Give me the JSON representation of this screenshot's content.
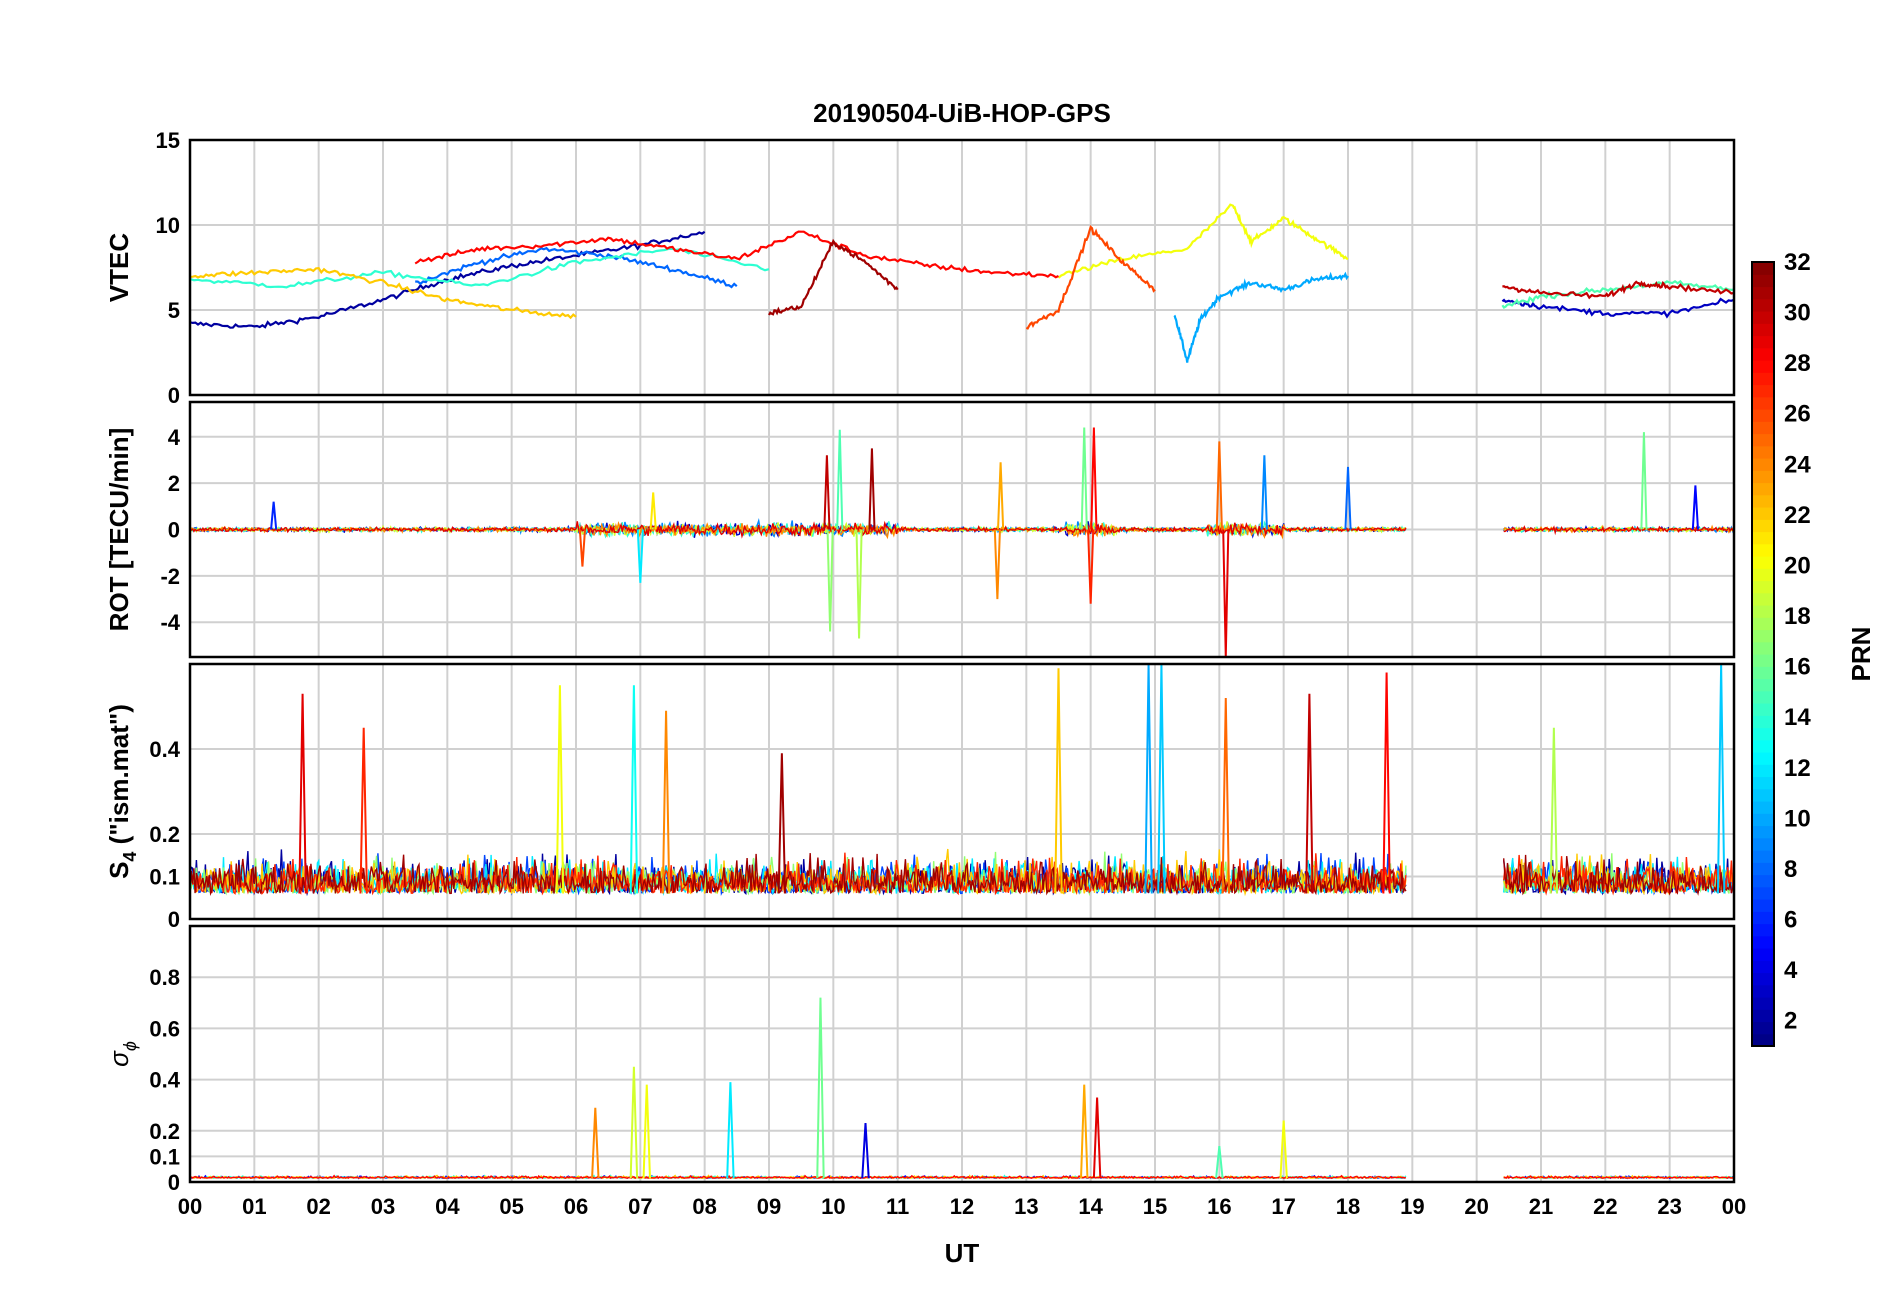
{
  "chart_data": {
    "type": "line",
    "title": "20190504-UiB-HOP-GPS",
    "xlabel": "UT",
    "x_ticks": [
      "00",
      "01",
      "02",
      "03",
      "04",
      "05",
      "06",
      "07",
      "08",
      "09",
      "10",
      "11",
      "12",
      "13",
      "14",
      "15",
      "16",
      "17",
      "18",
      "19",
      "20",
      "21",
      "22",
      "23",
      "00"
    ],
    "x_range_hours": [
      0,
      24
    ],
    "grid": true,
    "data_gap_hours": [
      18.9,
      20.4
    ],
    "panels": [
      {
        "ylabel": "VTEC",
        "ylim": [
          0,
          15
        ],
        "yticks": [
          "0",
          "5",
          "10",
          "15"
        ],
        "ytick_values": [
          0,
          5,
          10,
          15
        ],
        "representative_series": [
          {
            "prn": 2,
            "x": [
              0.0,
              1.0,
              2.0,
              3.0,
              4.0,
              5.0,
              6.0,
              7.0,
              8.0
            ],
            "y": [
              4.2,
              4.0,
              4.6,
              5.6,
              6.8,
              7.6,
              8.2,
              8.8,
              9.6
            ]
          },
          {
            "prn": 8,
            "x": [
              3.5,
              4.5,
              5.5,
              6.5,
              7.5,
              8.5
            ],
            "y": [
              6.6,
              7.8,
              8.6,
              8.2,
              7.4,
              6.4
            ]
          },
          {
            "prn": 10,
            "x": [
              15.3,
              15.5,
              15.7,
              16.0,
              16.5,
              17.0,
              17.5,
              18.0
            ],
            "y": [
              4.8,
              2.0,
              4.4,
              5.8,
              6.6,
              6.2,
              6.8,
              7.0
            ]
          },
          {
            "prn": 14,
            "x": [
              0.0,
              1.5,
              3.0,
              4.5,
              6.0,
              7.5,
              9.0
            ],
            "y": [
              6.8,
              6.4,
              7.2,
              6.4,
              7.8,
              8.6,
              7.4
            ]
          },
          {
            "prn": 20,
            "x": [
              13.5,
              14.5,
              15.5,
              16.2,
              16.5,
              17.0,
              17.5,
              18.0
            ],
            "y": [
              7.0,
              8.0,
              8.6,
              11.2,
              9.0,
              10.4,
              9.2,
              8.0
            ]
          },
          {
            "prn": 22,
            "x": [
              0.0,
              1.0,
              2.0,
              3.0,
              4.0,
              5.0,
              6.0
            ],
            "y": [
              7.0,
              7.2,
              7.4,
              6.6,
              5.6,
              5.0,
              4.6
            ]
          },
          {
            "prn": 26,
            "x": [
              13.0,
              13.5,
              14.0,
              14.5,
              15.0
            ],
            "y": [
              4.0,
              5.0,
              9.8,
              7.8,
              6.2
            ]
          },
          {
            "prn": 28,
            "x": [
              3.5,
              4.5,
              5.5,
              6.5,
              7.5,
              8.5,
              9.5,
              10.5,
              11.5,
              12.5,
              13.5
            ],
            "y": [
              7.8,
              8.6,
              8.8,
              9.2,
              8.6,
              8.0,
              9.6,
              8.2,
              7.6,
              7.2,
              7.0
            ]
          },
          {
            "prn": 31,
            "x": [
              9.0,
              9.5,
              10.0,
              10.5,
              11.0
            ],
            "y": [
              4.8,
              5.2,
              9.0,
              7.8,
              6.2
            ]
          },
          {
            "prn": 3,
            "x": [
              20.4,
              21.0,
              22.0,
              23.0,
              24.0
            ],
            "y": [
              5.6,
              5.2,
              4.8,
              4.8,
              5.6
            ]
          },
          {
            "prn": 15,
            "x": [
              20.4,
              21.0,
              22.0,
              23.0,
              24.0
            ],
            "y": [
              5.2,
              5.8,
              6.2,
              6.6,
              6.2
            ]
          },
          {
            "prn": 30,
            "x": [
              20.4,
              21.0,
              22.0,
              22.5,
              23.0,
              24.0
            ],
            "y": [
              6.4,
              6.0,
              5.8,
              6.6,
              6.4,
              6.0
            ]
          }
        ]
      },
      {
        "ylabel": "ROT [TECU/min]",
        "ylim": [
          -5.5,
          5.5
        ],
        "yticks": [
          "-4",
          "-2",
          "0",
          "2",
          "4"
        ],
        "ytick_values": [
          -4,
          -2,
          0,
          2,
          4
        ],
        "representative_spikes": [
          {
            "prn": 6,
            "x": 1.3,
            "y": 1.2
          },
          {
            "prn": 26,
            "x": 6.1,
            "y": -1.6
          },
          {
            "prn": 12,
            "x": 7.0,
            "y": -2.3
          },
          {
            "prn": 21,
            "x": 7.2,
            "y": 1.6
          },
          {
            "prn": 30,
            "x": 9.9,
            "y": 3.2
          },
          {
            "prn": 17,
            "x": 9.95,
            "y": -4.4
          },
          {
            "prn": 15,
            "x": 10.1,
            "y": 4.3
          },
          {
            "prn": 18,
            "x": 10.4,
            "y": -4.7
          },
          {
            "prn": 31,
            "x": 10.6,
            "y": 3.5
          },
          {
            "prn": 23,
            "x": 12.6,
            "y": 2.9
          },
          {
            "prn": 24,
            "x": 12.55,
            "y": -3.0
          },
          {
            "prn": 16,
            "x": 13.9,
            "y": 4.4
          },
          {
            "prn": 28,
            "x": 14.05,
            "y": 4.4
          },
          {
            "prn": 27,
            "x": 14.0,
            "y": -3.2
          },
          {
            "prn": 25,
            "x": 16.0,
            "y": 3.8
          },
          {
            "prn": 29,
            "x": 16.1,
            "y": -5.5
          },
          {
            "prn": 9,
            "x": 16.7,
            "y": 3.2
          },
          {
            "prn": 8,
            "x": 18.0,
            "y": 2.7
          },
          {
            "prn": 16,
            "x": 22.6,
            "y": 4.2
          },
          {
            "prn": 5,
            "x": 23.4,
            "y": 1.9
          }
        ]
      },
      {
        "ylabel": "S4 (\"ism.mat\")",
        "ylabel_main": "S",
        "ylabel_sub": "4",
        "ylabel_rest": " (\"ism.mat\")",
        "ylim": [
          0,
          0.6
        ],
        "yticks": [
          "0",
          "0.1",
          "0.2",
          "0.4"
        ],
        "ytick_values": [
          0,
          0.1,
          0.2,
          0.4
        ],
        "representative_peaks": [
          {
            "prn": 29,
            "x": 1.75,
            "y": 0.53
          },
          {
            "prn": 27,
            "x": 2.7,
            "y": 0.45
          },
          {
            "prn": 20,
            "x": 5.75,
            "y": 0.55
          },
          {
            "prn": 13,
            "x": 6.9,
            "y": 0.55
          },
          {
            "prn": 24,
            "x": 7.4,
            "y": 0.49
          },
          {
            "prn": 31,
            "x": 9.2,
            "y": 0.39
          },
          {
            "prn": 22,
            "x": 13.5,
            "y": 0.59
          },
          {
            "prn": 10,
            "x": 14.9,
            "y": 0.6
          },
          {
            "prn": 11,
            "x": 15.1,
            "y": 0.6
          },
          {
            "prn": 25,
            "x": 16.1,
            "y": 0.52
          },
          {
            "prn": 30,
            "x": 17.4,
            "y": 0.53
          },
          {
            "prn": 28,
            "x": 18.6,
            "y": 0.58
          },
          {
            "prn": 18,
            "x": 21.2,
            "y": 0.45
          },
          {
            "prn": 11,
            "x": 23.8,
            "y": 0.6
          }
        ]
      },
      {
        "ylabel": "σ ϕ",
        "ylabel_sigma": "σ",
        "ylabel_sub": "ϕ",
        "ylim": [
          0,
          1.0
        ],
        "yticks": [
          "0",
          "0.1",
          "0.2",
          "0.4",
          "0.6",
          "0.8"
        ],
        "ytick_values": [
          0,
          0.1,
          0.2,
          0.4,
          0.6,
          0.8
        ],
        "representative_peaks": [
          {
            "prn": 24,
            "x": 6.3,
            "y": 0.29
          },
          {
            "prn": 19,
            "x": 6.9,
            "y": 0.45
          },
          {
            "prn": 20,
            "x": 7.1,
            "y": 0.38
          },
          {
            "prn": 12,
            "x": 8.4,
            "y": 0.39
          },
          {
            "prn": 16,
            "x": 9.8,
            "y": 0.72
          },
          {
            "prn": 4,
            "x": 10.5,
            "y": 0.23
          },
          {
            "prn": 23,
            "x": 13.9,
            "y": 0.38
          },
          {
            "prn": 29,
            "x": 14.1,
            "y": 0.33
          },
          {
            "prn": 15,
            "x": 16.0,
            "y": 0.14
          },
          {
            "prn": 20,
            "x": 17.0,
            "y": 0.24
          }
        ]
      }
    ],
    "colorbar": {
      "label": "PRN",
      "range": [
        1,
        32
      ],
      "ticks": [
        "2",
        "4",
        "6",
        "8",
        "10",
        "12",
        "14",
        "16",
        "18",
        "20",
        "22",
        "24",
        "26",
        "28",
        "30",
        "32"
      ],
      "tick_values": [
        2,
        4,
        6,
        8,
        10,
        12,
        14,
        16,
        18,
        20,
        22,
        24,
        26,
        28,
        30,
        32
      ],
      "colormap": "jet"
    }
  }
}
